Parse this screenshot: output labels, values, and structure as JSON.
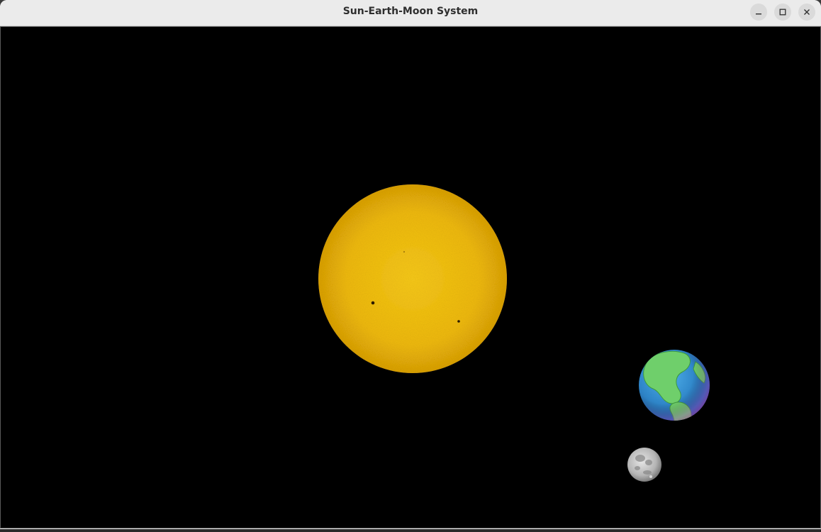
{
  "window": {
    "title": "Sun-Earth-Moon System",
    "controls": {
      "minimize_icon": "minimize-icon",
      "maximize_icon": "maximize-icon",
      "close_icon": "close-icon"
    }
  },
  "scene": {
    "background": "#000000",
    "bodies": {
      "sun": {
        "name": "sun",
        "color": "#f2bf0a"
      },
      "earth": {
        "name": "earth",
        "color": "#3a8fd0"
      },
      "moon": {
        "name": "moon",
        "color": "#bdbdbd"
      }
    }
  }
}
